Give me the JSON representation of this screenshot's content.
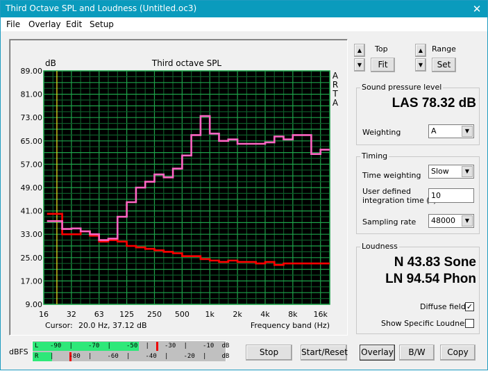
{
  "window": {
    "title": "Third Octave SPL and Loudness (Untitled.oc3)",
    "close_glyph": "✕"
  },
  "menu": [
    "File",
    "Overlay",
    "Edit",
    "Setup"
  ],
  "chart_data": {
    "type": "line",
    "step": true,
    "title": "Third octave SPL",
    "ylabel": "dB",
    "xlabel": "Frequency band (Hz)",
    "ylim": [
      9,
      89
    ],
    "yticks": [
      "89.00",
      "81.00",
      "73.00",
      "65.00",
      "57.00",
      "49.00",
      "41.00",
      "33.00",
      "25.00",
      "17.00",
      "9.00"
    ],
    "xtick_labels": [
      "16",
      "32",
      "63",
      "125",
      "250",
      "500",
      "1k",
      "2k",
      "4k",
      "8k",
      "16k"
    ],
    "grid": true,
    "watermark": [
      "A",
      "R",
      "T",
      "A"
    ],
    "bands": [
      "16",
      "20",
      "25",
      "31.5",
      "40",
      "50",
      "63",
      "80",
      "100",
      "125",
      "160",
      "200",
      "250",
      "315",
      "400",
      "500",
      "630",
      "800",
      "1k",
      "1.25k",
      "1.6k",
      "2k",
      "2.5k",
      "3.15k",
      "4k",
      "5k",
      "6.3k",
      "8k",
      "10k",
      "12.5k",
      "16k"
    ],
    "series": [
      {
        "name": "overlay",
        "color": "#ff0000",
        "values": [
          40,
          40,
          33,
          33,
          34,
          32.5,
          30.5,
          31,
          30.5,
          29,
          28.5,
          28,
          27.5,
          27,
          26.5,
          25.5,
          25.5,
          24.5,
          24,
          23.5,
          24,
          23.5,
          23.5,
          23,
          23.5,
          22.5,
          23,
          23,
          23,
          23,
          23
        ]
      },
      {
        "name": "current",
        "color": "#ff66c4",
        "values": [
          37.5,
          37.5,
          34.8,
          35,
          34,
          33,
          31,
          31.5,
          39,
          44,
          49,
          51,
          53.5,
          52.5,
          55.5,
          60,
          67,
          73.5,
          67.5,
          65,
          65.5,
          64,
          64,
          64,
          64.5,
          66.5,
          65.5,
          67,
          67,
          60.5,
          62
        ]
      }
    ],
    "cursor": {
      "band": "20",
      "label": "Cursor:",
      "value": "20.0 Hz, 37.12 dB",
      "color": "#e8d820"
    },
    "colors": {
      "background": "#000000",
      "grid_major": "#1ea34a",
      "grid_minor": "#0e5a28"
    }
  },
  "controls": {
    "top_label": "Top",
    "fit_label": "Fit",
    "range_label": "Range",
    "set_label": "Set"
  },
  "spl": {
    "legend": "Sound pressure level",
    "value": "LAS 78.32 dB",
    "weighting_label": "Weighting",
    "weighting_value": "A"
  },
  "timing": {
    "legend": "Timing",
    "time_weighting_label": "Time weighting",
    "time_weighting_value": "Slow",
    "integration_label_1": "User defined",
    "integration_label_2": "integration time (s)",
    "integration_value": "10",
    "sampling_rate_label": "Sampling rate",
    "sampling_rate_value": "48000"
  },
  "loudness": {
    "legend": "Loudness",
    "sone": "N 43.83 Sone",
    "phon": "LN 94.54 Phon",
    "diffuse_field_label": "Diffuse field",
    "diffuse_field_checked": true,
    "specific_loudness_label": "Show Specific Loudness",
    "specific_loudness_checked": false
  },
  "meter": {
    "label": "dBFS",
    "left": {
      "channel": "L",
      "level_fraction": 0.55,
      "peak_fraction": 0.64,
      "ticks": [
        "-90",
        "|",
        "-70",
        "|",
        "-50",
        "|",
        "-30",
        "|",
        "-10",
        "dB"
      ]
    },
    "right": {
      "channel": "R",
      "level_fraction": 0.1,
      "peak_fraction": 0.19,
      "ticks": [
        "|",
        "-80",
        "|",
        "-60",
        "|",
        "-40",
        "|",
        "-20",
        "|",
        "dB"
      ]
    }
  },
  "buttons": {
    "stop": "Stop",
    "start_reset": "Start/Reset",
    "overlay": "Overlay",
    "bw": "B/W",
    "copy": "Copy"
  }
}
